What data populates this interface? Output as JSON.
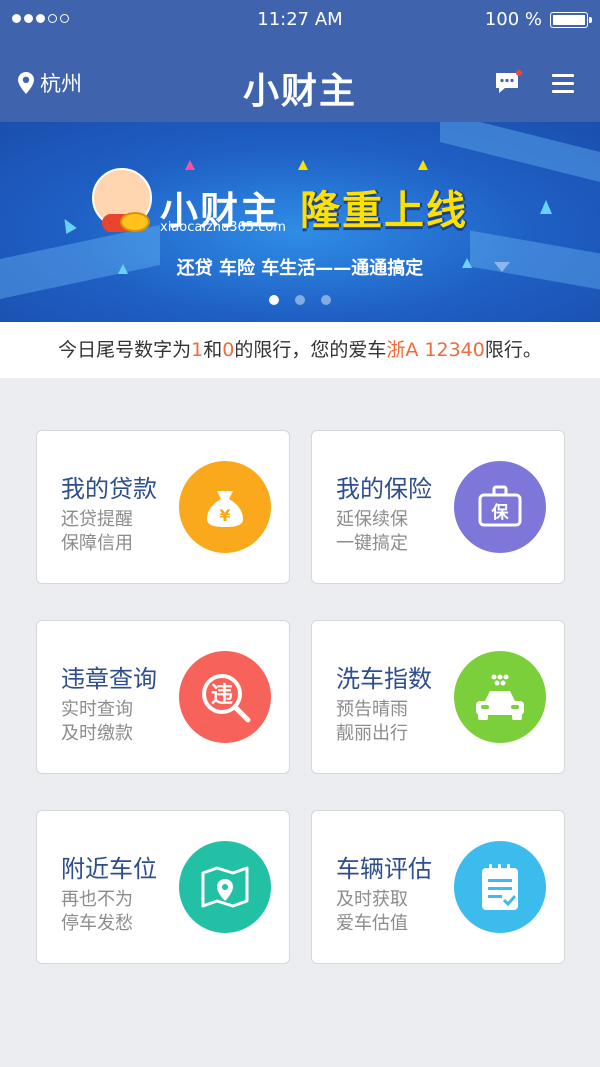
{
  "status_bar": {
    "time": "11:27 AM",
    "battery": "100 %",
    "signal_dots_filled": 3,
    "signal_dots_total": 5
  },
  "nav": {
    "location": "杭州",
    "logo_text": "小财主",
    "message_icon": "message-icon",
    "menu_icon": "menu-icon"
  },
  "banner": {
    "brand": "小财主",
    "url": "xiaocaizhu365.com",
    "slogan": "隆重上线",
    "subtitle": "还贷 车险 车生活——通通搞定",
    "pages": 3,
    "active_page": 1
  },
  "notice": {
    "part1": "今日尾号数字为",
    "digit1": "1",
    "part2": "和",
    "digit2": "0",
    "part3": "的限行，您的爱车",
    "plate": "浙A 12340",
    "part4": "限行。"
  },
  "cards": [
    {
      "title": "我的贷款",
      "line1": "还贷提醒",
      "line2": "保障信用",
      "icon": "money-bag-icon",
      "icon_text": "¥",
      "color": "#f9a91b"
    },
    {
      "title": "我的保险",
      "line1": "延保续保",
      "line2": "一键搞定",
      "icon": "insurance-case-icon",
      "icon_text": "保",
      "color": "#7d77d9"
    },
    {
      "title": "违章查询",
      "line1": "实时查询",
      "line2": "及时缴款",
      "icon": "violation-search-icon",
      "icon_text": "违",
      "color": "#f7625b"
    },
    {
      "title": "洗车指数",
      "line1": "预告晴雨",
      "line2": "靓丽出行",
      "icon": "car-wash-icon",
      "color": "#7bcf3a"
    },
    {
      "title": "附近车位",
      "line1": "再也不为",
      "line2": "停车发愁",
      "icon": "map-pin-icon",
      "color": "#22c1a6"
    },
    {
      "title": "车辆评估",
      "line1": "及时获取",
      "line2": "爱车估值",
      "icon": "notepad-icon",
      "color": "#3cbcec"
    }
  ]
}
